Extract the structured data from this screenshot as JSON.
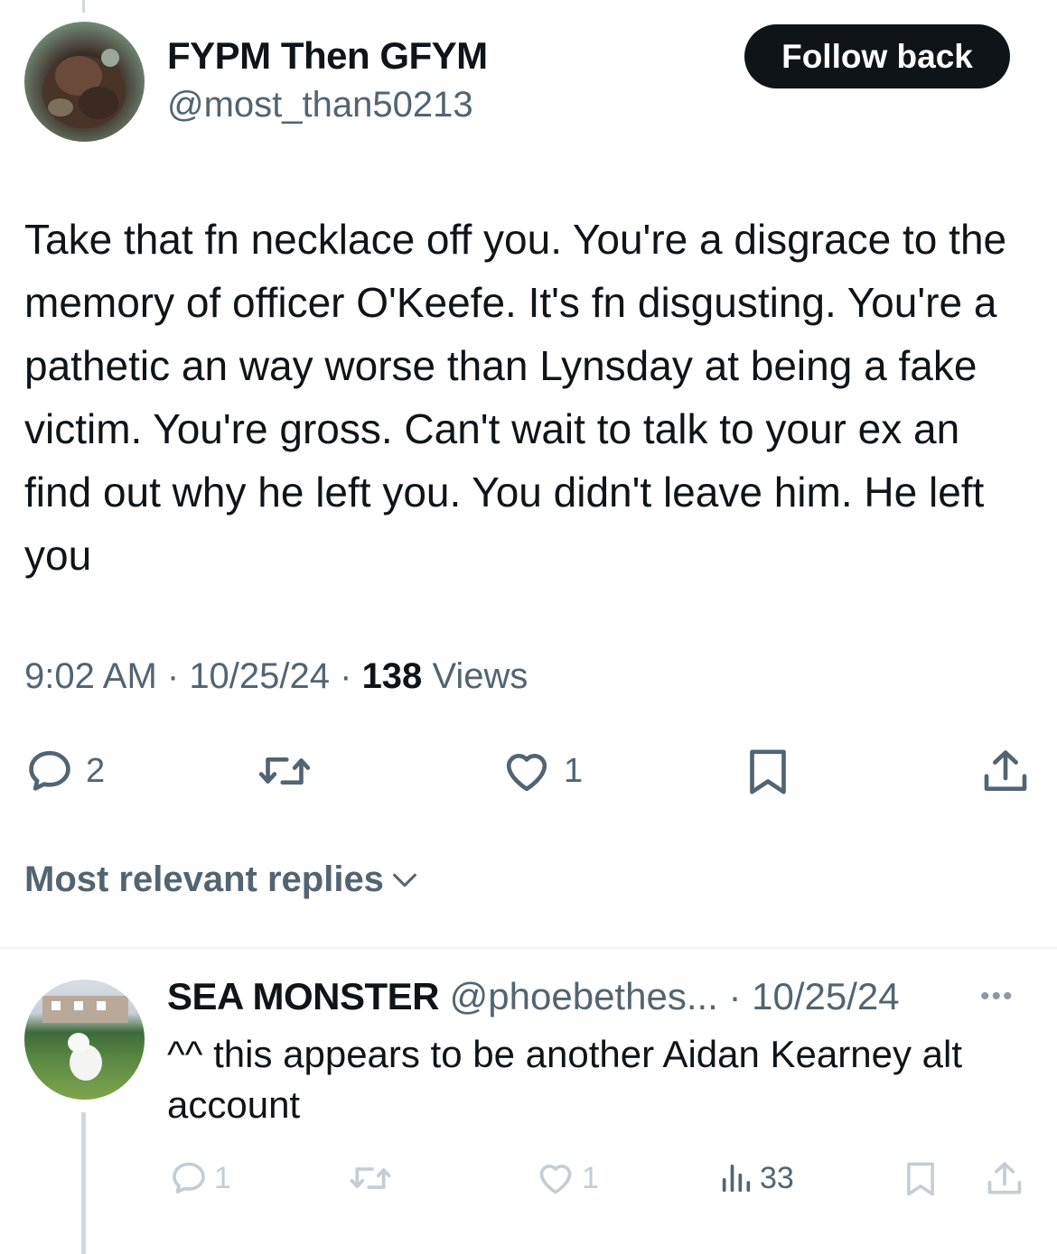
{
  "tweet": {
    "author_name": "FYPM Then GFYM",
    "author_handle": "@most_than50213",
    "follow_label": "Follow back",
    "text": "Take that fn necklace off you. You're a disgrace to the memory of officer O'Keefe. It's fn disgusting. You're a pathetic an way worse than Lynsday at being a fake victim. You're gross. Can't wait to talk to your ex an find out why he left you. You didn't leave him. He left you",
    "time": "9:02 AM",
    "date": "10/25/24",
    "views_count": "138",
    "views_label": "Views",
    "separator": " · ",
    "replies_count": "2",
    "likes_count": "1"
  },
  "replies_sort": {
    "label": "Most relevant replies"
  },
  "reply": {
    "author_name": "SEA MONSTER",
    "author_handle": "@phoebethes...",
    "date": "10/25/24",
    "separator": " · ",
    "more": "•••",
    "text": "^^ this appears to be another Aidan Kearney alt account",
    "replies_count": "1",
    "likes_count": "1",
    "views_count": "33"
  },
  "colors": {
    "text_primary": "#0f1419",
    "text_secondary": "#536471",
    "follow_bg": "#0f1419",
    "icon_muted": "#c4cdd3",
    "divider": "#eff3f4"
  },
  "icons": [
    "reply-icon",
    "retweet-icon",
    "like-icon",
    "bookmark-icon",
    "share-icon",
    "chevron-down-icon",
    "views-icon",
    "more-icon"
  ]
}
